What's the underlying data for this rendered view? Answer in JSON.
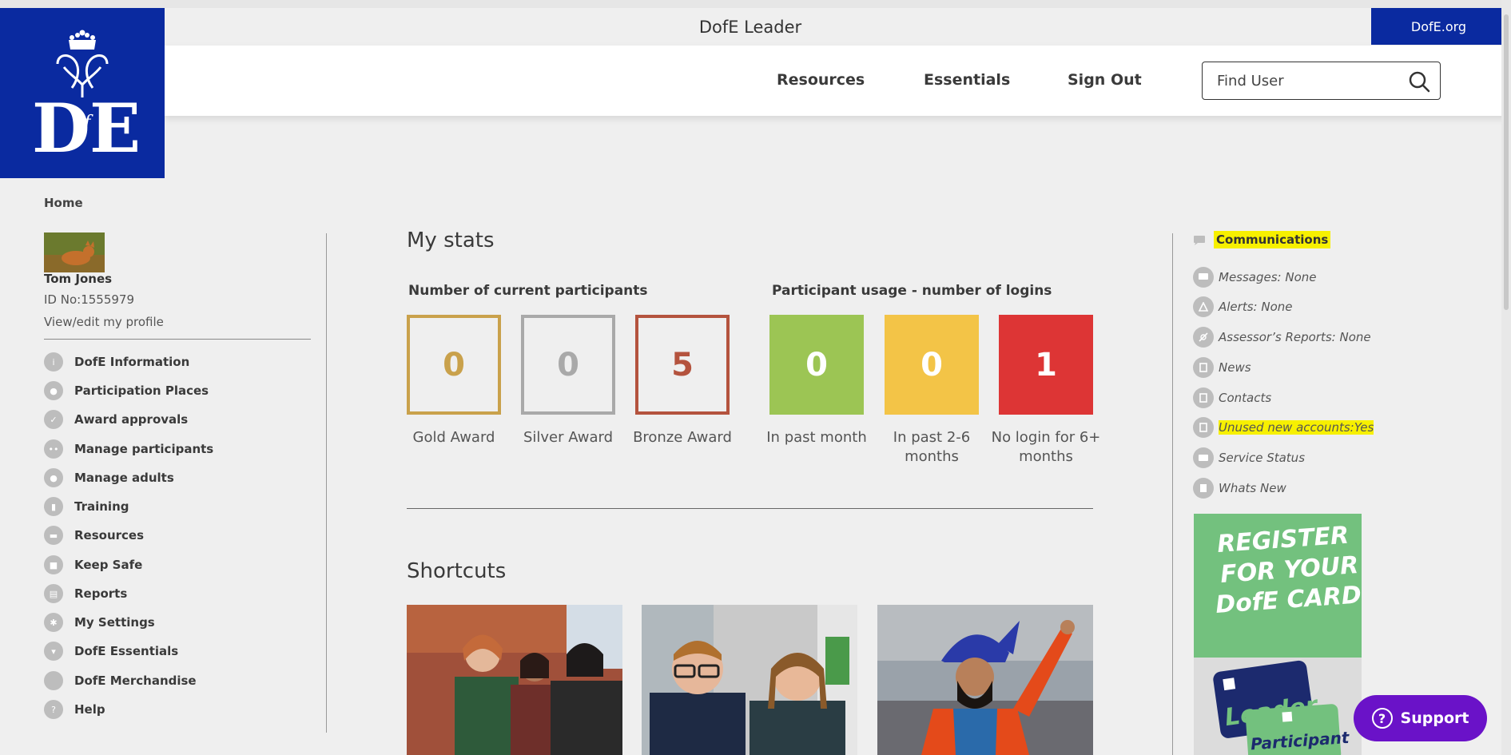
{
  "header": {
    "title": "DofE Leader",
    "external_link": "DofE.org",
    "nav": [
      "Resources",
      "Essentials",
      "Sign Out"
    ],
    "search_placeholder": "Find User",
    "brand_color": "#0a2aa0"
  },
  "logo": {
    "text": "DofE"
  },
  "sidebar": {
    "breadcrumb": "Home",
    "user_name": "Tom Jones",
    "user_id": "ID No:1555979",
    "profile_link": "View/edit my profile",
    "items": [
      {
        "label": "DofE Information",
        "icon": "info-icon"
      },
      {
        "label": "Participation Places",
        "icon": "person-icon"
      },
      {
        "label": "Award approvals",
        "icon": "shield-check-icon"
      },
      {
        "label": "Manage participants",
        "icon": "people-icon"
      },
      {
        "label": "Manage adults",
        "icon": "adults-icon"
      },
      {
        "label": "Training",
        "icon": "training-icon"
      },
      {
        "label": "Resources",
        "icon": "folder-icon"
      },
      {
        "label": "Keep Safe",
        "icon": "lock-icon"
      },
      {
        "label": "Reports",
        "icon": "report-icon"
      },
      {
        "label": "My Settings",
        "icon": "gear-icon"
      },
      {
        "label": "DofE Essentials",
        "icon": "cart-icon"
      },
      {
        "label": "DofE Merchandise",
        "icon": "merch-icon"
      },
      {
        "label": "Help",
        "icon": "help-icon"
      }
    ]
  },
  "stats": {
    "title": "My stats",
    "participants_title": "Number of current participants",
    "usage_title": "Participant usage - number of logins",
    "participants": [
      {
        "value": "0",
        "label": "Gold Award",
        "color": "#c9a14b"
      },
      {
        "value": "0",
        "label": "Silver Award",
        "color": "#a9a9a9"
      },
      {
        "value": "5",
        "label": "Bronze Award",
        "color": "#b4533e"
      }
    ],
    "usage": [
      {
        "value": "0",
        "label": "In past month",
        "color": "#9cc554"
      },
      {
        "value": "0",
        "label": "In past 2-6 months",
        "color": "#f3c447"
      },
      {
        "value": "1",
        "label": "No login for 6+ months",
        "color": "#dd3535"
      }
    ]
  },
  "shortcuts": {
    "title": "Shortcuts"
  },
  "communications": {
    "title": "Communications",
    "items": [
      {
        "label": "Messages: None",
        "icon": "message-icon",
        "highlight": false
      },
      {
        "label": "Alerts: None",
        "icon": "bell-icon",
        "highlight": false
      },
      {
        "label": "Assessor’s Reports: None",
        "icon": "report-off-icon",
        "highlight": false
      },
      {
        "label": "News",
        "icon": "news-icon",
        "highlight": false
      },
      {
        "label": "Contacts",
        "icon": "contacts-icon",
        "highlight": false
      },
      {
        "label": "Unused new accounts:Yes",
        "icon": "accounts-icon",
        "highlight": true
      },
      {
        "label": "Service Status",
        "icon": "status-icon",
        "highlight": false
      },
      {
        "label": "Whats New",
        "icon": "whats-new-icon",
        "highlight": false
      }
    ]
  },
  "promo": {
    "headline": [
      "REGISTER",
      "FOR YOUR",
      "DofE CARD"
    ],
    "card1": "Leader",
    "card2": "Participant"
  },
  "support_label": "Support"
}
